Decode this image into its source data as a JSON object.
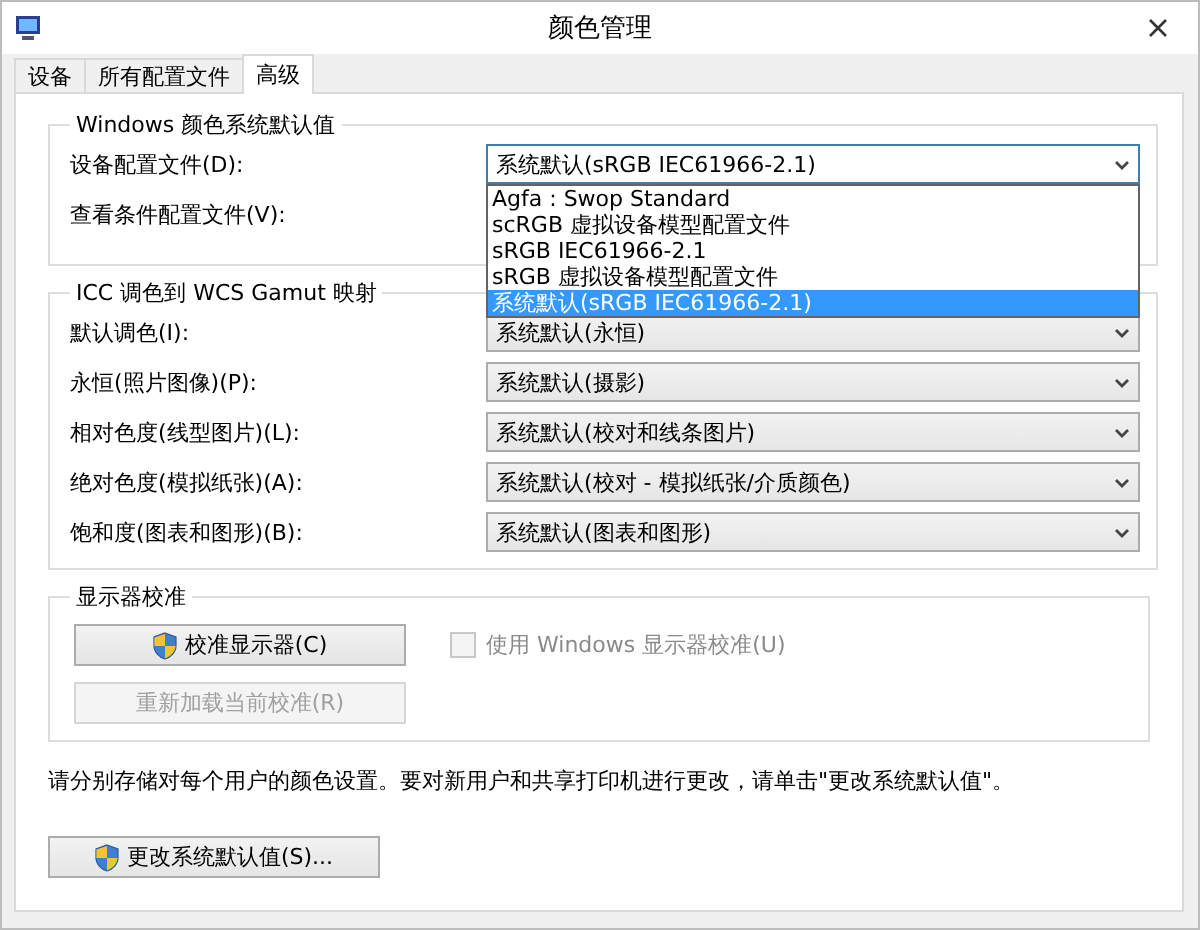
{
  "window": {
    "title": "颜色管理"
  },
  "tabs": [
    {
      "label": "设备",
      "selected": false
    },
    {
      "label": "所有配置文件",
      "selected": false
    },
    {
      "label": "高级",
      "selected": true
    }
  ],
  "windows_defaults": {
    "legend": "Windows 颜色系统默认值",
    "rows": [
      {
        "label": "设备配置文件(D):",
        "value": "系统默认(sRGB IEC61966-2.1)",
        "expanded": true
      },
      {
        "label": "查看条件配置文件(V):"
      }
    ],
    "dropdown_options": [
      {
        "label": "Agfa : Swop Standard",
        "selected": false
      },
      {
        "label": "scRGB 虚拟设备模型配置文件",
        "selected": false
      },
      {
        "label": "sRGB IEC61966-2.1",
        "selected": false
      },
      {
        "label": "sRGB 虚拟设备模型配置文件",
        "selected": false
      },
      {
        "label": "系统默认(sRGB IEC61966-2.1)",
        "selected": true
      }
    ]
  },
  "icc_mapping": {
    "legend": "ICC 调色到 WCS Gamut 映射",
    "rows": [
      {
        "label": "默认调色(I):",
        "value": "系统默认(永恒)"
      },
      {
        "label": "永恒(照片图像)(P):",
        "value": "系统默认(摄影)"
      },
      {
        "label": "相对色度(线型图片)(L):",
        "value": "系统默认(校对和线条图片)"
      },
      {
        "label": "绝对色度(模拟纸张)(A):",
        "value": "系统默认(校对 - 模拟纸张/介质颜色)"
      },
      {
        "label": "饱和度(图表和图形)(B):",
        "value": "系统默认(图表和图形)"
      }
    ]
  },
  "display_calibration": {
    "legend": "显示器校准",
    "calibrate_button": {
      "label": "校准显示器(C)",
      "disabled": false
    },
    "reload_button": {
      "label": "重新加载当前校准(R)",
      "disabled": true
    },
    "checkbox": {
      "label": "使用 Windows 显示器校准(U)",
      "checked": false,
      "disabled": true
    }
  },
  "note": "请分别存储对每个用户的颜色设置。要对新用户和共享打印机进行更改，请单击\"更改系统默认值\"。",
  "change_defaults_button": {
    "label": "更改系统默认值(S)..."
  }
}
